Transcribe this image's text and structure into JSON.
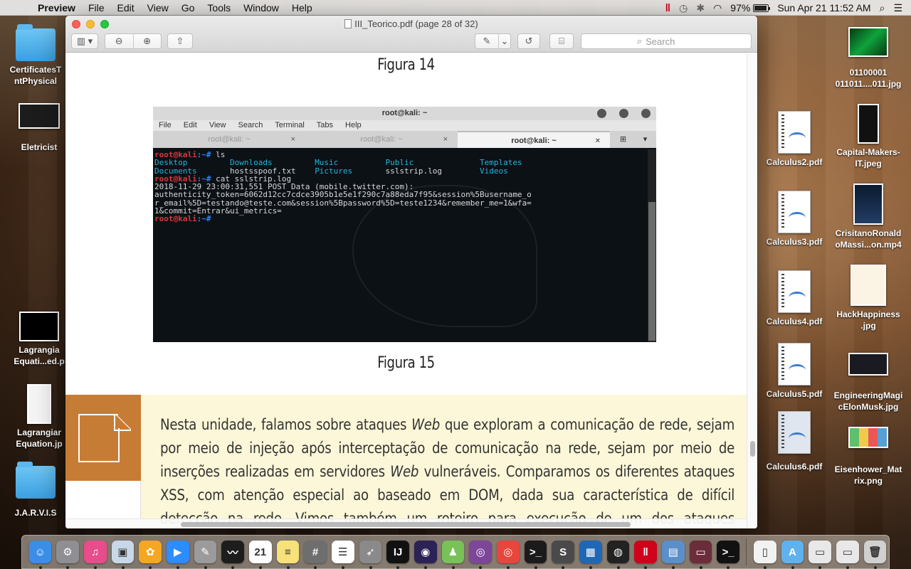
{
  "menubar": {
    "app_name": "Preview",
    "menus": [
      "File",
      "Edit",
      "View",
      "Go",
      "Tools",
      "Window",
      "Help"
    ],
    "battery": "97%",
    "clock": "Sun Apr 21  11:52 AM"
  },
  "desktop_left": [
    {
      "label": "CertificatesTrustedPhysical",
      "display": "CertificatesT\nntPhysical"
    },
    {
      "label": "Eletricist",
      "display": "Eletricist"
    },
    {
      "label": "Lagrangian Equati...ed.pdf",
      "display": "Lagrangia\nEquati...ed.p"
    },
    {
      "label": "Lagrangian Equation.jpg",
      "display": "Lagrangiar\nEquation.jp"
    },
    {
      "label": "J.A.R.V.I.S",
      "display": "J.A.R.V.I.S"
    }
  ],
  "desktop_right": [
    {
      "label": "01100001 011011....011.jpg",
      "display": "01100001\n011011....011.jpg"
    },
    {
      "label": "Calculus2.pdf",
      "display": "Calculus2.pdf"
    },
    {
      "label": "Capital-Makers-IT.jpeg",
      "display": "Capital-Makers-\nIT.jpeg"
    },
    {
      "label": "Calculus3.pdf",
      "display": "Calculus3.pdf"
    },
    {
      "label": "CrisitanoRonaldoMassi...on.mp4",
      "display": "CrisitanoRonald\noMassi...on.mp4"
    },
    {
      "label": "Calculus4.pdf",
      "display": "Calculus4.pdf"
    },
    {
      "label": "HackHappiness.jpg",
      "display": "HackHappiness\n.jpg"
    },
    {
      "label": "Calculus5.pdf",
      "display": "Calculus5.pdf"
    },
    {
      "label": "EngineeringMagicElonMusk.jpg",
      "display": "EngineeringMagi\ncElonMusk.jpg"
    },
    {
      "label": "Calculus6.pdf",
      "display": "Calculus6.pdf"
    },
    {
      "label": "Eisenhower_Matrix.png",
      "display": "Eisenhower_Mat\nrix.png"
    }
  ],
  "window": {
    "title": "III_Teorico.pdf (page 28 of 32)",
    "search_placeholder": "Search"
  },
  "document": {
    "figure14_caption": "Figura 14",
    "figure15_caption": "Figura 15",
    "summary_text": "Nesta unidade, falamos sobre ataques Web que exploram a comunicação de rede, sejam por meio de injeção após interceptação de comunicação na rede, sejam por meio de inserções realizadas em servidores Web vulneráveis. Comparamos os diferentes ataques XSS, com atenção especial ao baseado em DOM, dada sua característica de difícil detecção na rede. Vimos também um roteiro para execução de um dos ataques estudados, o de quebra"
  },
  "terminal": {
    "title": "root@kali: ~",
    "menu": [
      "File",
      "Edit",
      "View",
      "Search",
      "Terminal",
      "Tabs",
      "Help"
    ],
    "tabs": [
      "root@kali: ~",
      "root@kali: ~",
      "root@kali: ~"
    ],
    "prompt": "root@kali",
    "path": ":~#",
    "cmd1": " ls",
    "ls_row1": [
      "Desktop",
      "Downloads",
      "Music",
      "Public",
      "Templates"
    ],
    "ls_row2": [
      "Documents",
      "hostsspoof.txt",
      "Pictures",
      "sslstrip.log",
      "Videos"
    ],
    "cmd2": " cat sslstrip.log",
    "log_lines": [
      "2018-11-29 23:00:31,551 POST Data (mobile.twitter.com):",
      "authenticity_token=6062d12cc7cdce3905b1e5e1f290c7a88eda7f95&session%5Busername_o",
      "r_email%5D=testando@teste.com&session%5Bpassword%5D=teste1234&remember_me=1&wfa=",
      "1&commit=Entrar&ui_metrics="
    ]
  },
  "dock_apps": [
    {
      "name": "Finder",
      "icon": "finder-icon",
      "color": "#3a8ee6",
      "glyph": "☺"
    },
    {
      "name": "System Preferences",
      "icon": "gear-icon",
      "color": "#8e8e93",
      "glyph": "⚙"
    },
    {
      "name": "iTunes",
      "icon": "music-icon",
      "color": "#e94c8a",
      "glyph": "♫"
    },
    {
      "name": "Preview",
      "icon": "preview-icon",
      "color": "#c9d8e8",
      "glyph": "▣"
    },
    {
      "name": "Photos",
      "icon": "photos-icon",
      "color": "#f5a623",
      "glyph": "✿"
    },
    {
      "name": "Zoom",
      "icon": "camera-icon",
      "color": "#2d8cff",
      "glyph": "▶"
    },
    {
      "name": "Script Editor",
      "icon": "script-icon",
      "color": "#9b9b9b",
      "glyph": "✎"
    },
    {
      "name": "Activity Monitor",
      "icon": "activity-icon",
      "color": "#1d1d1d",
      "glyph": "〰"
    },
    {
      "name": "Calendar",
      "icon": "calendar-icon",
      "color": "#ffffff",
      "glyph": "21"
    },
    {
      "name": "Notes",
      "icon": "notes-icon",
      "color": "#f7e27a",
      "glyph": "≡"
    },
    {
      "name": "Calculator",
      "icon": "calculator-icon",
      "color": "#6e6e6e",
      "glyph": "#"
    },
    {
      "name": "Reminders",
      "icon": "reminders-icon",
      "color": "#ffffff",
      "glyph": "☰"
    },
    {
      "name": "Launchpad",
      "icon": "rocket-icon",
      "color": "#8a8a8a",
      "glyph": "➶"
    },
    {
      "name": "IntelliJ IDEA",
      "icon": "intellij-icon",
      "color": "#111111",
      "glyph": "IJ"
    },
    {
      "name": "Eclipse",
      "icon": "eclipse-icon",
      "color": "#2c2255",
      "glyph": "◉"
    },
    {
      "name": "Android Studio",
      "icon": "android-icon",
      "color": "#78c257",
      "glyph": "♟"
    },
    {
      "name": "Tor Browser",
      "icon": "tor-icon",
      "color": "#7d4698",
      "glyph": "◎"
    },
    {
      "name": "Chrome",
      "icon": "chrome-icon",
      "color": "#e8453c",
      "glyph": "◎"
    },
    {
      "name": "Terminal",
      "icon": "terminal-icon",
      "color": "#1b1b1b",
      "glyph": ">_"
    },
    {
      "name": "Sublime Text",
      "icon": "sublime-icon",
      "color": "#4a4a4a",
      "glyph": "S"
    },
    {
      "name": "VirtualBox",
      "icon": "virtualbox-icon",
      "color": "#1f68b5",
      "glyph": "▦"
    },
    {
      "name": "Screen Recorder",
      "icon": "record-icon",
      "color": "#222222",
      "glyph": "◍"
    },
    {
      "name": "Parallels",
      "icon": "parallels-icon",
      "color": "#d0021b",
      "glyph": "‖"
    },
    {
      "name": "Image Capture",
      "icon": "image-capture-icon",
      "color": "#5b8fc9",
      "glyph": "▤"
    },
    {
      "name": "Window Thumbnail",
      "icon": "window-icon",
      "color": "#6b2d3a",
      "glyph": "▭"
    },
    {
      "name": "Terminal Window",
      "icon": "terminal-window-icon",
      "color": "#111111",
      "glyph": ">_"
    }
  ],
  "dock_right": [
    {
      "name": "Document",
      "icon": "document-icon",
      "color": "#f2f2f2",
      "glyph": "▯"
    },
    {
      "name": "Applications",
      "icon": "applications-icon",
      "color": "#5fb2ee",
      "glyph": "A"
    },
    {
      "name": "Screenshot",
      "icon": "screenshot-icon",
      "color": "#e8e8e8",
      "glyph": "▭"
    },
    {
      "name": "Screenshot 2",
      "icon": "screenshot-icon",
      "color": "#e8e8e8",
      "glyph": "▭"
    },
    {
      "name": "Trash",
      "icon": "trash-icon",
      "color": "#d0d0d0",
      "glyph": "🗑"
    }
  ]
}
